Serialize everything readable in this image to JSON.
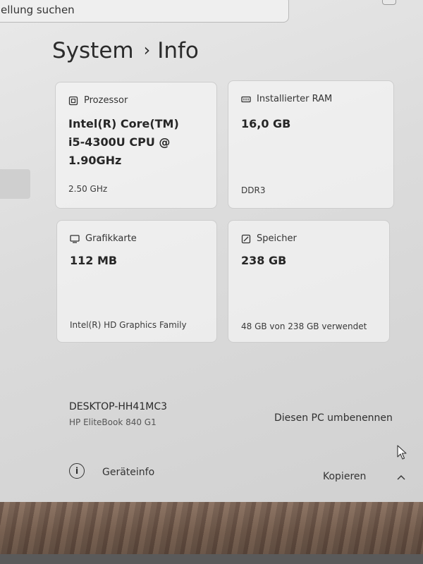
{
  "search": {
    "text": "ellung suchen"
  },
  "breadcrumb": {
    "parent": "System",
    "separator": "›",
    "current": "Info"
  },
  "cards": {
    "processor": {
      "label": "Prozessor",
      "value": "Intel(R) Core(TM)\ni5-4300U CPU @\n1.90GHz",
      "footer": "2.50 GHz"
    },
    "ram": {
      "label": "Installierter RAM",
      "value": "16,0 GB",
      "footer": "DDR3"
    },
    "graphics": {
      "label": "Grafikkarte",
      "value": "112 MB",
      "footer": "Intel(R) HD Graphics Family"
    },
    "storage": {
      "label": "Speicher",
      "value": "238 GB",
      "footer": "48 GB von 238 GB verwendet"
    }
  },
  "device": {
    "name": "DESKTOP-HH41MC3",
    "model": "HP EliteBook 840 G1",
    "rename_label": "Diesen PC umbenennen"
  },
  "device_info": {
    "label": "Geräteinfo",
    "copy_label": "Kopieren"
  }
}
